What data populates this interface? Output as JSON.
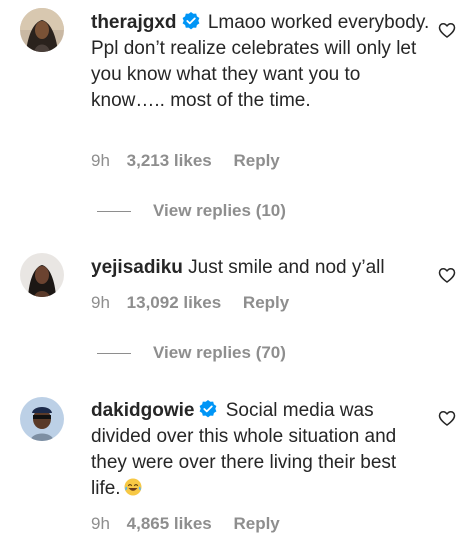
{
  "comments": [
    {
      "username": "therajgxd",
      "verified": true,
      "text": "Lmaoo worked everybody. Ppl don’t realize celebrates will only let you know what they want you to know….. most of the time.",
      "time": "9h",
      "likes": "3,213 likes",
      "reply_label": "Reply",
      "view_replies": "View replies (10)",
      "avatar_icon": "profile-photo"
    },
    {
      "username": "yejisadiku",
      "verified": false,
      "text": "Just smile and nod y’all",
      "time": "9h",
      "likes": "13,092 likes",
      "reply_label": "Reply",
      "view_replies": "View replies (70)",
      "avatar_icon": "profile-photo"
    },
    {
      "username": "dakidgowie",
      "verified": true,
      "text": "Social media was divided over this whole situation and they were over there living their best life.",
      "emoji": "face-with-tears-of-joy",
      "time": "9h",
      "likes": "4,865 likes",
      "reply_label": "Reply",
      "avatar_icon": "profile-photo"
    }
  ],
  "icons": {
    "like": "heart-outline-icon",
    "verified": "verified-badge-icon"
  },
  "colors": {
    "text": "#262626",
    "secondary": "#8e8e8e",
    "verified": "#0095f6"
  }
}
